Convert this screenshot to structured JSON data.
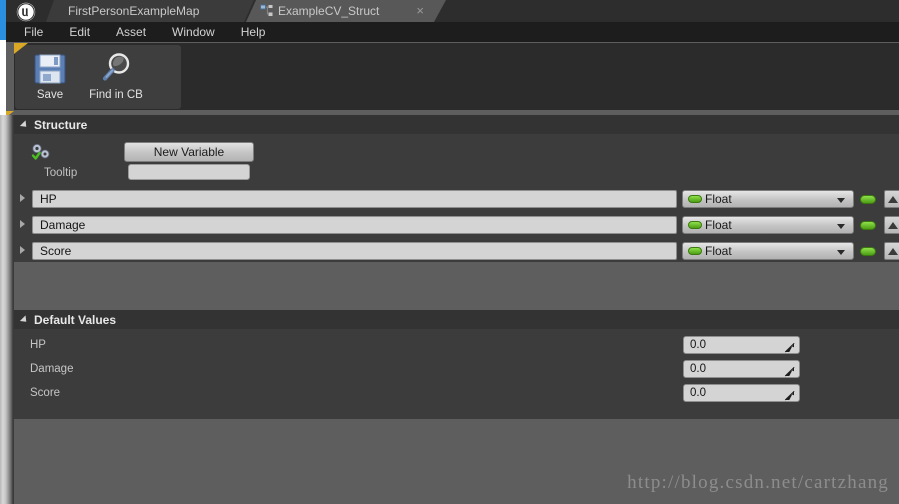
{
  "window": {
    "tabs": [
      {
        "label": "FirstPersonExampleMap",
        "active": false,
        "icon": ""
      },
      {
        "label": "ExampleCV_Struct",
        "active": true,
        "icon": "struct-icon",
        "close": "×"
      }
    ]
  },
  "menubar": {
    "items": [
      "File",
      "Edit",
      "Asset",
      "Window",
      "Help"
    ]
  },
  "toolbar": {
    "buttons": [
      {
        "label": "Save",
        "icon": "floppy-disk-icon"
      },
      {
        "label": "Find in CB",
        "icon": "magnifier-icon"
      }
    ]
  },
  "structure": {
    "title": "Structure",
    "new_variable_label": "New Variable",
    "variable_icon": "gear-check-icon",
    "tooltip_label": "Tooltip",
    "tooltip_value": "",
    "tooltip_placeholder": "",
    "rows": [
      {
        "name": "HP",
        "type": "Float",
        "pin_color": "#6fc42a"
      },
      {
        "name": "Damage",
        "type": "Float",
        "pin_color": "#6fc42a"
      },
      {
        "name": "Score",
        "type": "Float",
        "pin_color": "#6fc42a"
      }
    ]
  },
  "default_values": {
    "title": "Default Values",
    "rows": [
      {
        "label": "HP",
        "value": "0.0"
      },
      {
        "label": "Damage",
        "value": "0.0"
      },
      {
        "label": "Score",
        "value": "0.0"
      }
    ]
  },
  "watermark": {
    "text": "http://blog.csdn.net/cartzhang"
  },
  "colors": {
    "accent_blue": "#2b8fe0",
    "panel_corner": "#d9a825",
    "pin_green": "#6fc42a",
    "panel_bg": "#3c3c3c",
    "canvas_bg": "#5e5e5e"
  }
}
